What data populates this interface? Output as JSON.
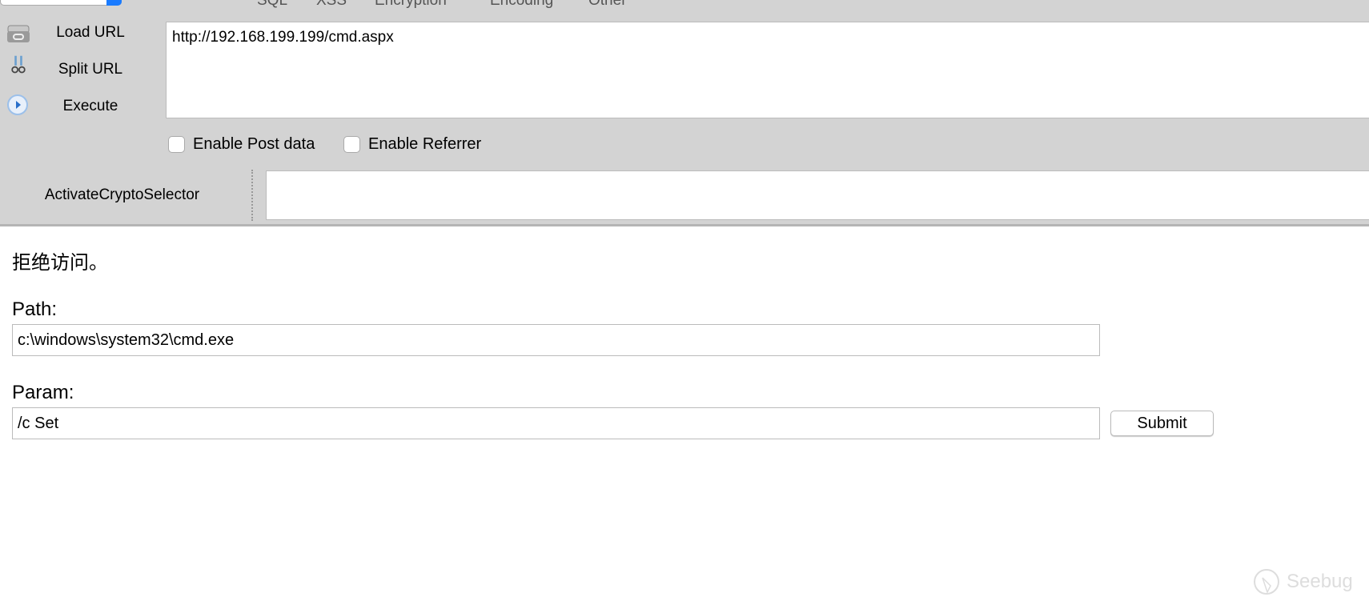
{
  "menu": [
    "SQL",
    "XSS",
    "Encryption",
    "Encoding",
    "Other"
  ],
  "side": {
    "load_url": "Load URL",
    "split_url": "Split URL",
    "execute": "Execute"
  },
  "url": "http://192.168.199.199/cmd.aspx",
  "options": {
    "post_data": "Enable Post data",
    "referrer": "Enable Referrer"
  },
  "crypto": {
    "label": "ActivateCryptoSelector",
    "value": ""
  },
  "page": {
    "message": "拒绝访问。",
    "path_label": "Path:",
    "path_value": "c:\\windows\\system32\\cmd.exe",
    "param_label": "Param:",
    "param_value": "/c Set",
    "submit": "Submit"
  },
  "watermark": "Seebug"
}
